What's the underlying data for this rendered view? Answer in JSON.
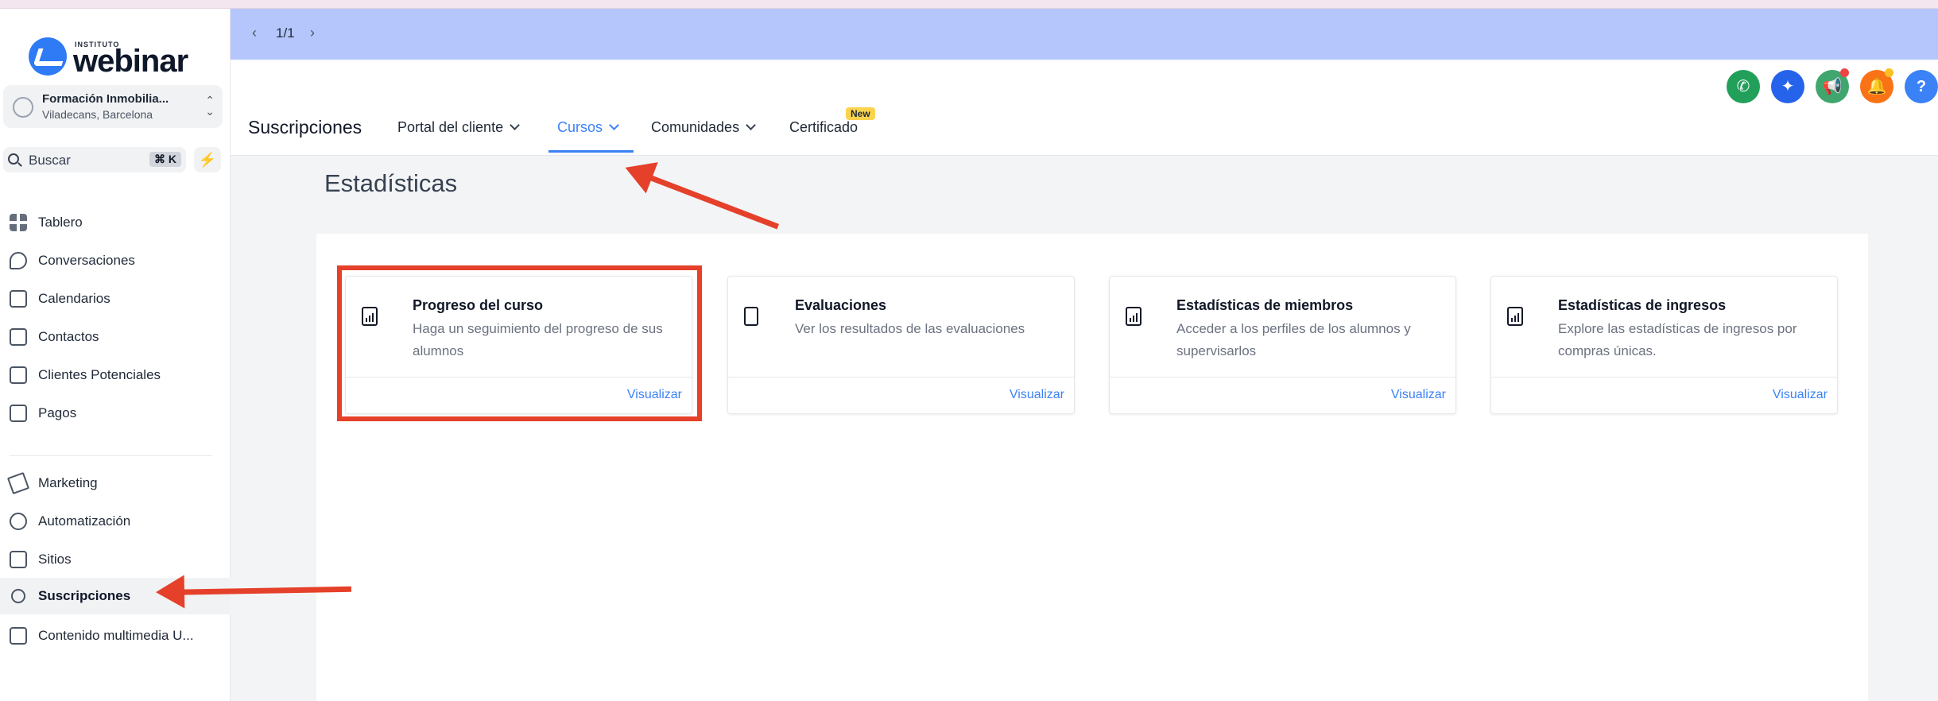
{
  "logo": {
    "small": "INSTITUTO",
    "big": "webinar"
  },
  "account": {
    "name": "Formación Inmobilia...",
    "location": "Viladecans, Barcelona"
  },
  "search": {
    "label": "Buscar",
    "shortcut": "⌘ K"
  },
  "sidebar": {
    "items": [
      {
        "label": "Tablero"
      },
      {
        "label": "Conversaciones"
      },
      {
        "label": "Calendarios"
      },
      {
        "label": "Contactos"
      },
      {
        "label": "Clientes Potenciales"
      },
      {
        "label": "Pagos"
      },
      {
        "label": "Marketing"
      },
      {
        "label": "Automatización"
      },
      {
        "label": "Sitios"
      },
      {
        "label": "Suscripciones"
      },
      {
        "label": "Contenido multimedia U..."
      }
    ]
  },
  "banner": {
    "pager": "1/1"
  },
  "header": {
    "title": "Suscripciones",
    "tabs": [
      {
        "label": "Portal del cliente"
      },
      {
        "label": "Cursos"
      },
      {
        "label": "Comunidades"
      },
      {
        "label": "Certificado"
      }
    ],
    "new_badge": "New"
  },
  "content": {
    "title": "Estadísticas",
    "cards": [
      {
        "title": "Progreso del curso",
        "desc": "Haga un seguimiento del progreso de sus alumnos",
        "link": "Visualizar"
      },
      {
        "title": "Evaluaciones",
        "desc": "Ver los resultados de las evaluaciones",
        "link": "Visualizar"
      },
      {
        "title": "Estadísticas de miembros",
        "desc": "Acceder a los perfiles de los alumnos y supervisarlos",
        "link": "Visualizar"
      },
      {
        "title": "Estadísticas de ingresos",
        "desc": "Explore las estadísticas de ingresos por compras únicas.",
        "link": "Visualizar"
      }
    ]
  },
  "colors": {
    "accent": "#3b82f6",
    "banner": "#b4c6fb",
    "annotation": "#e5402a"
  }
}
